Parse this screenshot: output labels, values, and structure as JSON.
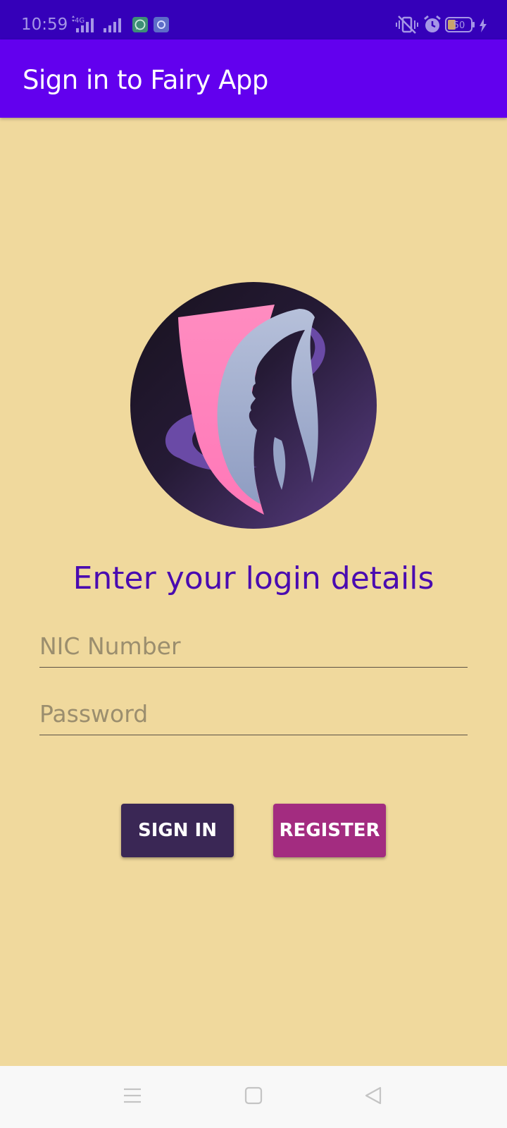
{
  "status_bar": {
    "time": "10:59",
    "network_label": "4G",
    "battery_level": "50",
    "icons": [
      "network-4g-icon",
      "signal-icon",
      "signal-icon",
      "whatsapp-icon",
      "app-notification-icon",
      "vibrate-silent-icon",
      "alarm-icon",
      "battery-icon",
      "charging-icon"
    ]
  },
  "app_bar": {
    "title": "Sign in to Fairy App"
  },
  "main": {
    "heading": "Enter your login details",
    "nic_field": {
      "value": "",
      "placeholder": "NIC Number"
    },
    "password_field": {
      "value": "",
      "placeholder": "Password"
    },
    "signin_label": "SIGN IN",
    "register_label": "REGISTER"
  },
  "nav_bar": {
    "icons": [
      "menu-icon",
      "home-icon",
      "back-icon"
    ]
  },
  "colors": {
    "status_bar": "#3500b9",
    "app_bar": "#6200ee",
    "background": "#f0d99d",
    "heading": "#4a0bb0",
    "signin_button": "#3a2755",
    "register_button": "#a32c80"
  }
}
